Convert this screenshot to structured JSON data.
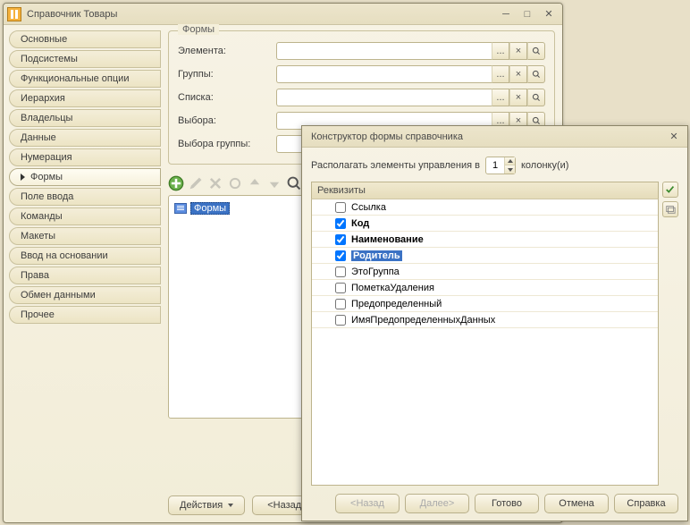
{
  "main": {
    "title": "Справочник Товары",
    "tabs": [
      "Основные",
      "Подсистемы",
      "Функциональные опции",
      "Иерархия",
      "Владельцы",
      "Данные",
      "Нумерация",
      "Формы",
      "Поле ввода",
      "Команды",
      "Макеты",
      "Ввод на основании",
      "Права",
      "Обмен данными",
      "Прочее"
    ],
    "activeTabIndex": 7,
    "forms": {
      "legend": "Формы",
      "rows": [
        {
          "label": "Элемента:"
        },
        {
          "label": "Группы:"
        },
        {
          "label": "Списка:"
        },
        {
          "label": "Выбора:"
        },
        {
          "label": "Выбора группы:"
        }
      ],
      "ellipsis": "...",
      "treeSelected": "Формы"
    },
    "bottom": {
      "actions": "Действия",
      "back": "<Назад"
    }
  },
  "dialog": {
    "title": "Конструктор формы справочника",
    "columnsLabelA": "Располагать элементы управления в",
    "columnsValue": "1",
    "columnsLabelB": "колонку(и)",
    "listHeader": "Реквизиты",
    "items": [
      {
        "label": "Ссылка",
        "checked": false,
        "bold": false,
        "selected": false
      },
      {
        "label": "Код",
        "checked": true,
        "bold": true,
        "selected": false
      },
      {
        "label": "Наименование",
        "checked": true,
        "bold": true,
        "selected": false
      },
      {
        "label": "Родитель",
        "checked": true,
        "bold": true,
        "selected": true
      },
      {
        "label": "ЭтоГруппа",
        "checked": false,
        "bold": false,
        "selected": false
      },
      {
        "label": "ПометкаУдаления",
        "checked": false,
        "bold": false,
        "selected": false
      },
      {
        "label": "Предопределенный",
        "checked": false,
        "bold": false,
        "selected": false
      },
      {
        "label": "ИмяПредопределенныхДанных",
        "checked": false,
        "bold": false,
        "selected": false
      }
    ],
    "buttons": {
      "back": "<Назад",
      "next": "Далее>",
      "done": "Готово",
      "cancel": "Отмена",
      "help": "Справка"
    }
  }
}
